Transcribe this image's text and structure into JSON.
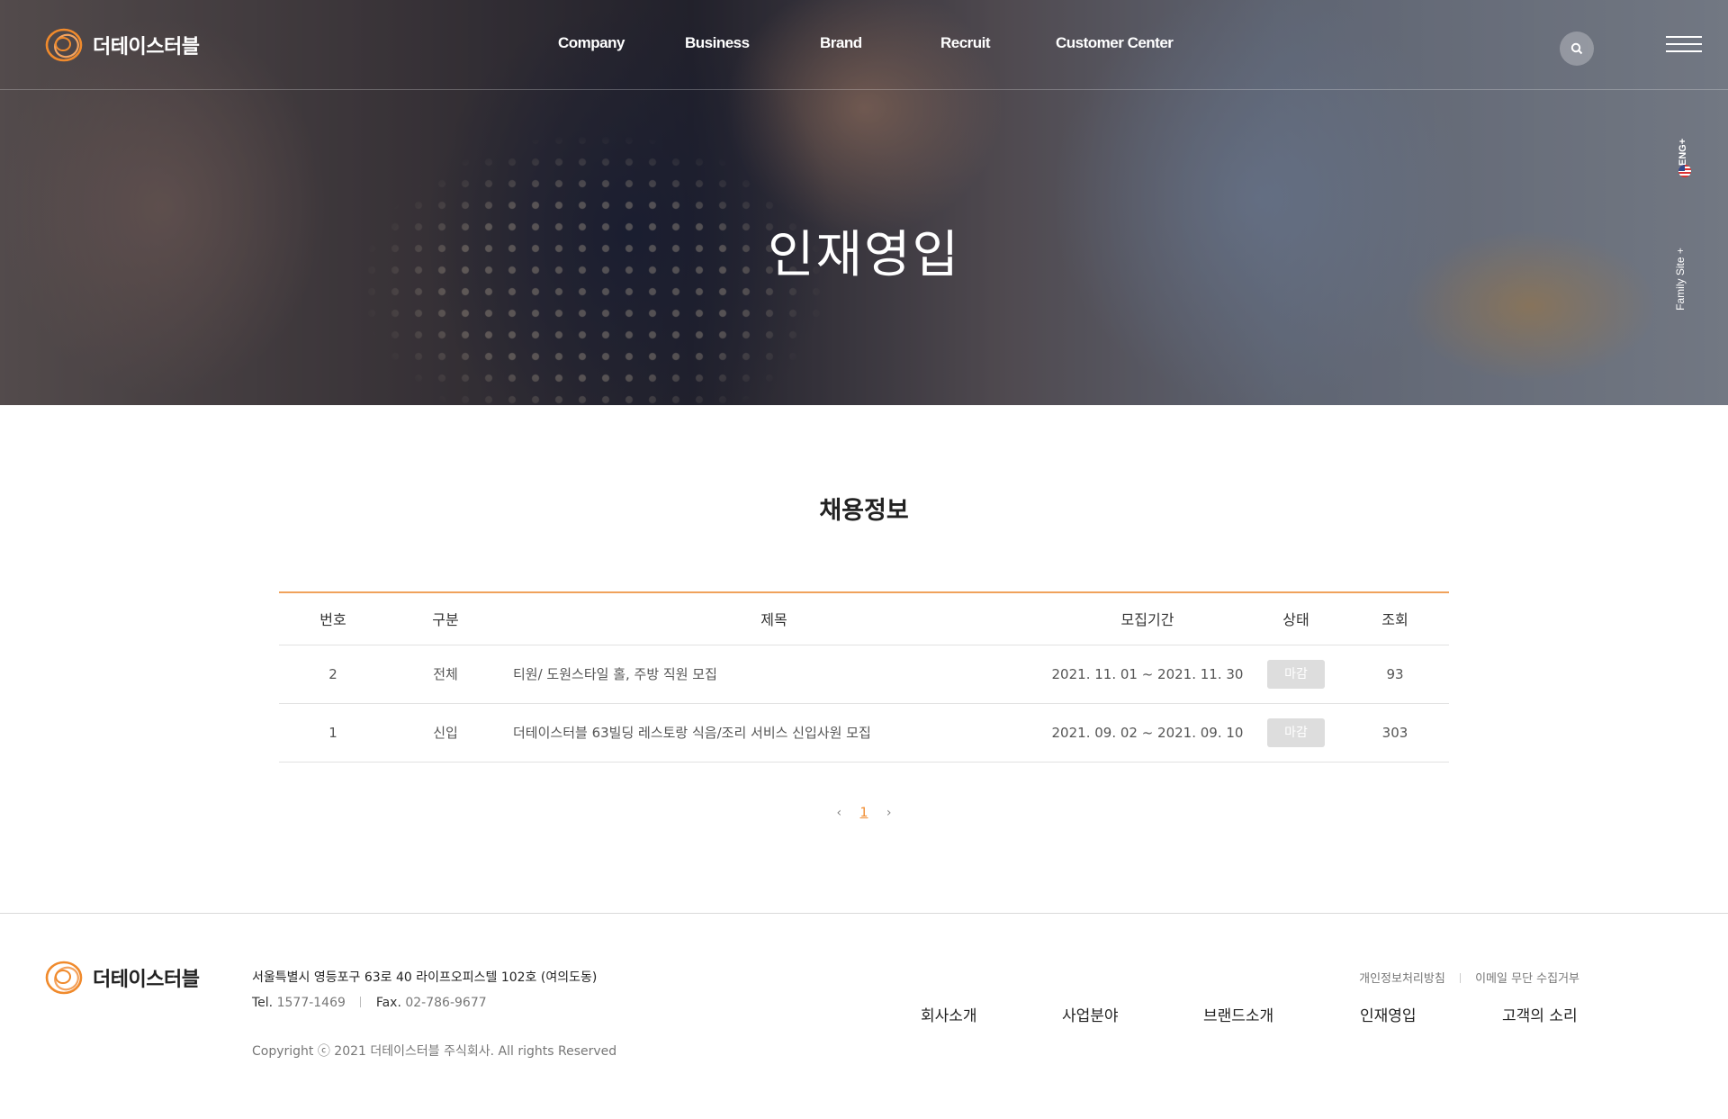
{
  "brand": {
    "name": "더테이스터블",
    "accent": "#f08a2c",
    "line_accent": "#f0a25b"
  },
  "nav": {
    "items": [
      "Company",
      "Business",
      "Brand",
      "Recruit",
      "Customer Center"
    ]
  },
  "side": {
    "lang": "ENG+",
    "family_site": "Family Site +"
  },
  "hero": {
    "title": "인재영입"
  },
  "section": {
    "title": "채용정보"
  },
  "board": {
    "headers": [
      "번호",
      "구분",
      "제목",
      "모집기간",
      "상태",
      "조회"
    ],
    "rows": [
      {
        "no": "2",
        "category": "전체",
        "title": "티원/ 도원스타일 홀, 주방 직원 모집",
        "period": "2021. 11. 01 ~ 2021. 11. 30",
        "status": "마감",
        "views": "93"
      },
      {
        "no": "1",
        "category": "신입",
        "title": "더테이스터블 63빌딩 레스토랑 식음/조리 서비스 신입사원 모집",
        "period": "2021. 09. 02 ~ 2021. 09. 10",
        "status": "마감",
        "views": "303"
      }
    ]
  },
  "pagination": {
    "prev": "‹",
    "current": "1",
    "next": "›"
  },
  "footer": {
    "address": "서울특별시 영등포구 63로 40 라이프오피스텔 102호 (여의도동)",
    "tel_label": "Tel.",
    "tel": "1577-1469",
    "fax_label": "Fax.",
    "fax": "02-786-9677",
    "copyright": "Copyright ⓒ 2021 더테이스터블 주식회사. All rights Reserved",
    "util_links": [
      "개인정보처리방침",
      "이메일 무단 수집거부"
    ],
    "menu": [
      "회사소개",
      "사업분야",
      "브랜드소개",
      "인재영입",
      "고객의 소리"
    ]
  }
}
